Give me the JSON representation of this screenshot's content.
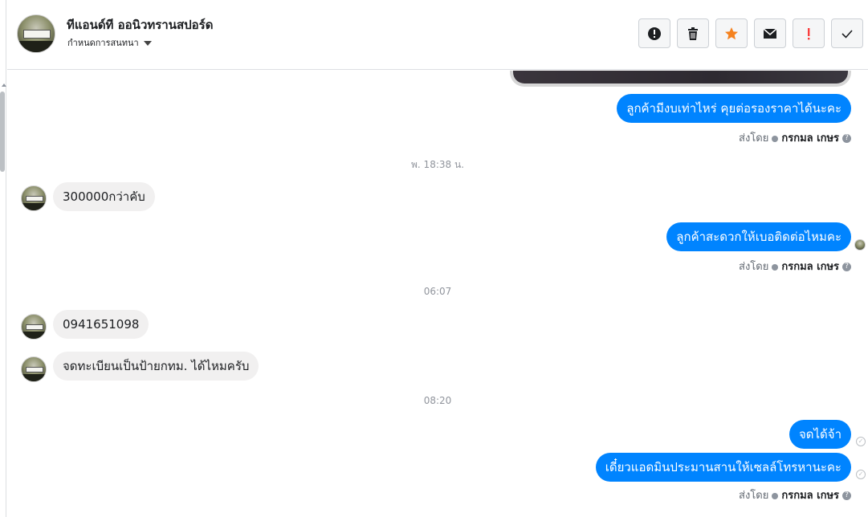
{
  "header": {
    "title": "ทีแอนด์ที ออนิวทรานสปอร์ด",
    "subtitle": "กำหนดการสนทนา"
  },
  "toolbar": {
    "buttons": [
      {
        "name": "report-spam-button",
        "icon": "alert-circle-icon"
      },
      {
        "name": "delete-button",
        "icon": "trash-icon"
      },
      {
        "name": "star-button",
        "icon": "star-icon",
        "color": "#f5821f"
      },
      {
        "name": "mark-unread-button",
        "icon": "envelope-icon"
      },
      {
        "name": "follow-up-button",
        "icon": "exclamation-icon",
        "color": "#fa3e3e"
      },
      {
        "name": "mark-done-button",
        "icon": "checkmark-icon"
      }
    ]
  },
  "sent_by": {
    "prefix": "ส่งโดย",
    "name": "กรกมล เกษร",
    "help": "?"
  },
  "messages": {
    "m1": "ลูกค้ามีงบเท่าไหร่ คุยต่อรองราคาได้นะคะ",
    "ts1": "พ. 18:38 น.",
    "m2": "300000กว่าคับ",
    "m3": "ลูกค้าสะดวกให้เบอติดต่อไหมคะ",
    "ts2": "06:07",
    "m4": "0941651098",
    "m5": "จดทะเบียนเป็นป้ายกทม. ได้ไหมครับ",
    "ts3": "08:20",
    "m6": "จดได้จ้า",
    "m7": "เดี๋ยวแอดมินประมานสานให้เซลล์โทรหานะคะ"
  },
  "colors": {
    "outgoing_bubble": "#0084ff",
    "incoming_bubble": "#f1f0f0"
  }
}
